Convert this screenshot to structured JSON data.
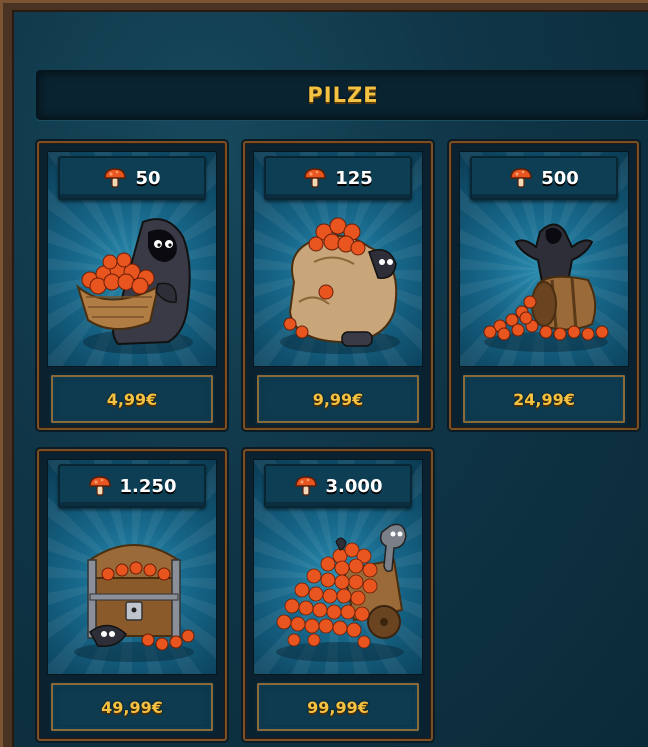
{
  "header": {
    "title": "PILZE"
  },
  "currency_icon": "mushroom-icon",
  "colors": {
    "accent_gold": "#f3c242",
    "frame_wood": "#7a4f26",
    "panel_teal": "#17678a",
    "mushroom_orange": "#e8551e"
  },
  "packages": [
    {
      "quantity": "50",
      "price": "4,99€",
      "art": "ghost-with-basket"
    },
    {
      "quantity": "125",
      "price": "9,99€",
      "art": "ghost-with-sack"
    },
    {
      "quantity": "500",
      "price": "24,99€",
      "art": "ghost-with-barrel"
    },
    {
      "quantity": "1.250",
      "price": "49,99€",
      "art": "treasure-chest"
    },
    {
      "quantity": "3.000",
      "price": "99,99€",
      "art": "cart-with-pile"
    }
  ]
}
